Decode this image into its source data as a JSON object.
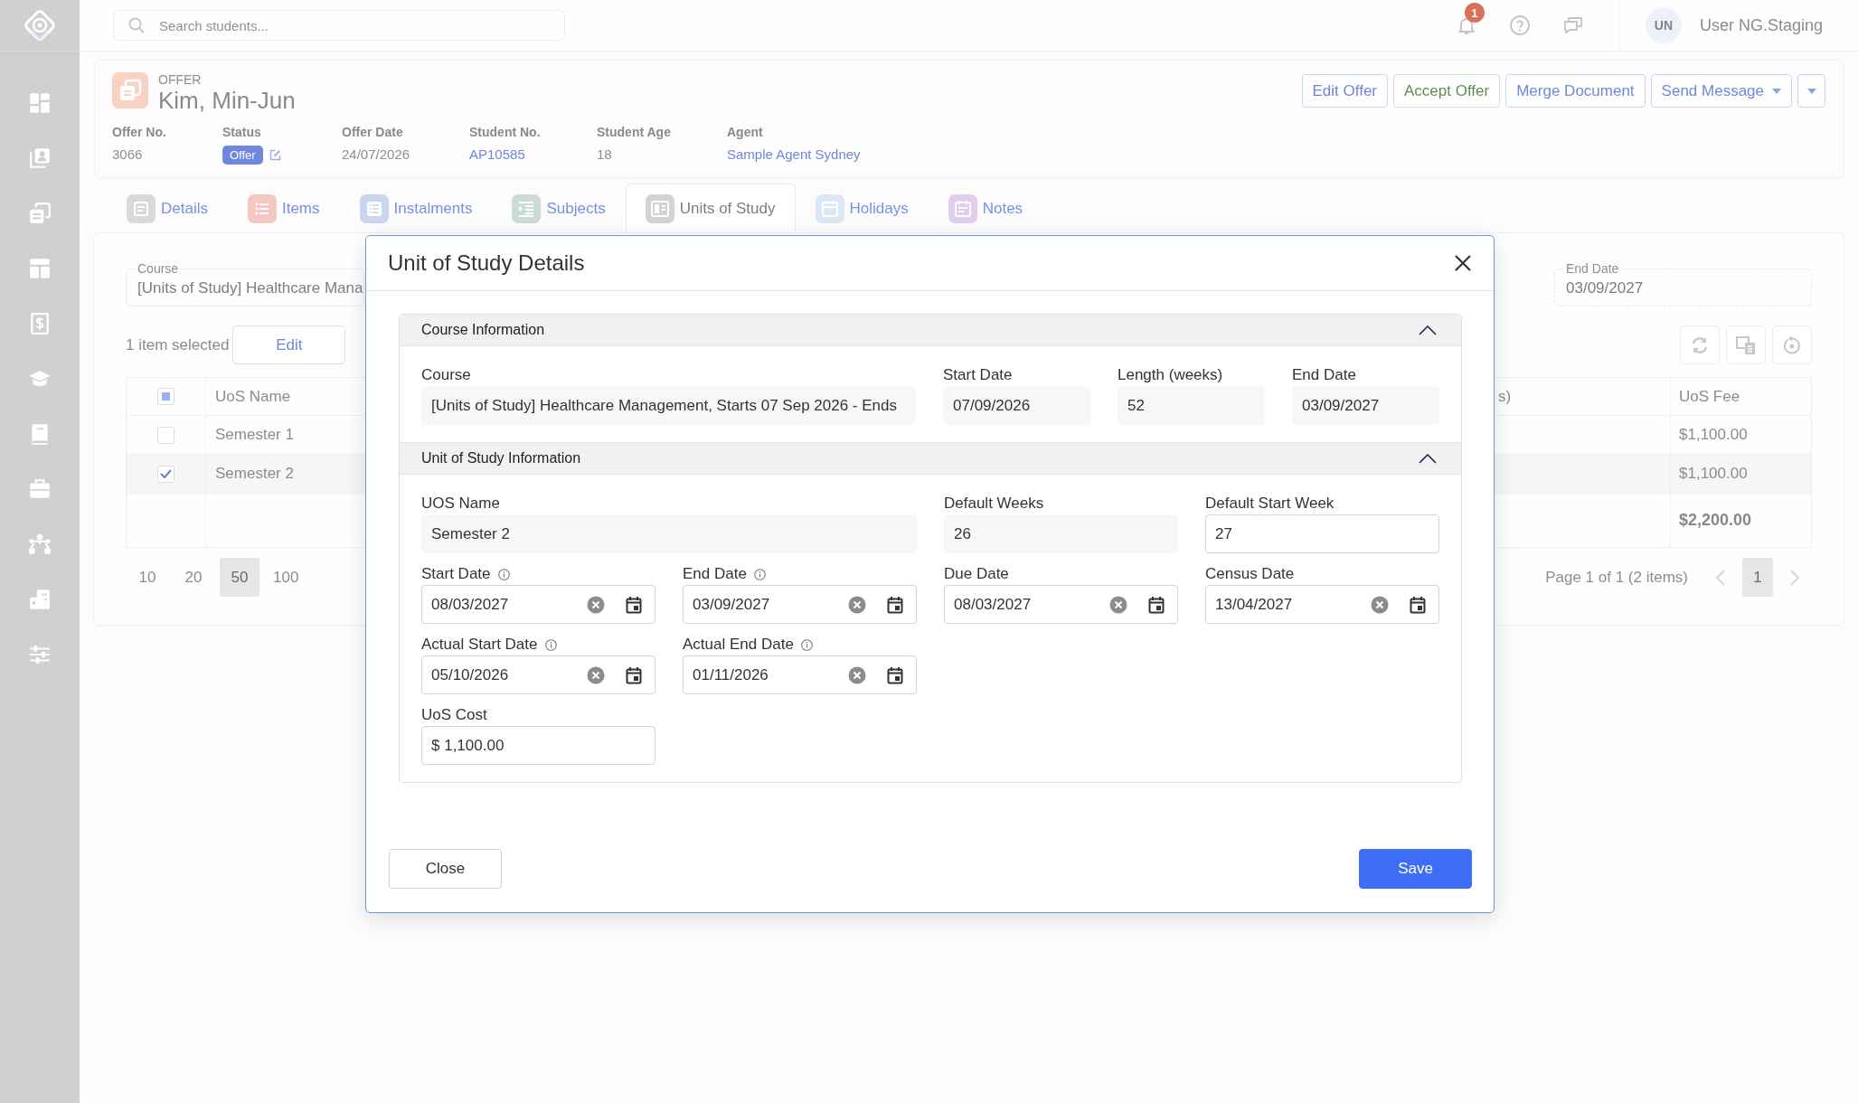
{
  "top_bar": {
    "search": {
      "placeholder": "Search students..."
    },
    "notification_count": "1",
    "user": {
      "initials": "UN",
      "name": "User NG.Staging"
    }
  },
  "offer": {
    "record_type": "OFFER",
    "student_name": "Kim, Min-Jun",
    "details": [
      {
        "label": "Offer No.",
        "value": "3066",
        "kind": "text"
      },
      {
        "label": "Status",
        "value": "Offer",
        "kind": "badge"
      },
      {
        "label": "Offer Date",
        "value": "24/07/2026",
        "kind": "text"
      },
      {
        "label": "Student No.",
        "value": "AP10585",
        "kind": "link"
      },
      {
        "label": "Student Age",
        "value": "18",
        "kind": "text"
      },
      {
        "label": "Agent",
        "value": "Sample Agent Sydney",
        "kind": "link"
      }
    ],
    "actions": [
      {
        "label": "Edit Offer",
        "kind": "primary"
      },
      {
        "label": "Accept Offer",
        "kind": "success"
      },
      {
        "label": "Merge Document",
        "kind": "primary"
      },
      {
        "label": "Send Message",
        "kind": "dropdown"
      }
    ]
  },
  "tabs": [
    {
      "label": "Details",
      "selected": false,
      "color": "#d9d9d9"
    },
    {
      "label": "Items",
      "selected": false,
      "color": "#f2c8c0"
    },
    {
      "label": "Instalments",
      "selected": false,
      "color": "#c8d7ef"
    },
    {
      "label": "Subjects",
      "selected": false,
      "color": "#cddbd5"
    },
    {
      "label": "Units of Study",
      "selected": true,
      "color": "#d3d3d3"
    },
    {
      "label": "Holidays",
      "selected": false,
      "color": "#dce7f5"
    },
    {
      "label": "Notes",
      "selected": false,
      "color": "#e2cdee"
    }
  ],
  "units_panel": {
    "course": {
      "label": "Course",
      "value": "[Units of Study] Healthcare Mana"
    },
    "end_date": {
      "label": "End Date",
      "value": "03/09/2027"
    },
    "selection_text": "1 item selected",
    "edit_button": "Edit",
    "table": {
      "select_all_indeterminate": true,
      "columns": [
        "UoS Name",
        "s)",
        "UoS Fee"
      ],
      "rows": [
        {
          "selected": false,
          "uos_name": "Semester 1",
          "uos_fee": "$1,100.00"
        },
        {
          "selected": true,
          "uos_name": "Semester 2",
          "uos_fee": "$1,100.00"
        }
      ],
      "total_fee": "$2,200.00"
    },
    "page_sizes": [
      {
        "label": "10",
        "selected": false
      },
      {
        "label": "20",
        "selected": false
      },
      {
        "label": "50",
        "selected": true
      },
      {
        "label": "100",
        "selected": false
      }
    ],
    "page_summary": "Page 1 of 1 (2 items)",
    "pages": [
      {
        "label": "1",
        "selected": true
      }
    ]
  },
  "dialog": {
    "title": "Unit of Study Details",
    "sections": [
      {
        "title": "Course Information",
        "expanded": true,
        "rows": [
          [
            {
              "label": "Course",
              "value": "[Units of Study] Healthcare Management, Starts 07 Sep 2026 - Ends",
              "kind": "readonly",
              "info": false
            },
            {
              "label": "Start Date",
              "value": "07/09/2026",
              "kind": "readonly",
              "info": false
            },
            {
              "label": "Length (weeks)",
              "value": "52",
              "kind": "readonly",
              "info": false
            },
            {
              "label": "End Date",
              "value": "03/09/2027",
              "kind": "readonly",
              "info": false
            }
          ]
        ]
      },
      {
        "title": "Unit of Study Information",
        "expanded": true,
        "rows": [
          [
            {
              "label": "UOS Name",
              "value": "Semester 2",
              "kind": "readonly",
              "info": false
            },
            null,
            {
              "label": "Default Weeks",
              "value": "26",
              "kind": "readonly",
              "info": false
            },
            {
              "label": "Default Start Week",
              "value": "27",
              "kind": "input",
              "info": false
            }
          ],
          [
            {
              "label": "Start Date",
              "value": "08/03/2027",
              "kind": "date",
              "info": true
            },
            {
              "label": "End Date",
              "value": "03/09/2027",
              "kind": "date",
              "info": true
            },
            {
              "label": "Due Date",
              "value": "08/03/2027",
              "kind": "date",
              "info": false
            },
            {
              "label": "Census Date",
              "value": "13/04/2027",
              "kind": "date",
              "info": false
            }
          ],
          [
            {
              "label": "Actual Start Date",
              "value": "05/10/2026",
              "kind": "date",
              "info": true
            },
            {
              "label": "Actual End Date",
              "value": "01/11/2026",
              "kind": "date",
              "info": true
            }
          ],
          [
            {
              "label": "UoS Cost",
              "value": "$ 1,100.00",
              "kind": "input",
              "info": false
            }
          ]
        ]
      }
    ],
    "buttons": [
      {
        "label": "Close",
        "kind": "secondary"
      },
      {
        "label": "Save",
        "kind": "primary"
      }
    ]
  }
}
